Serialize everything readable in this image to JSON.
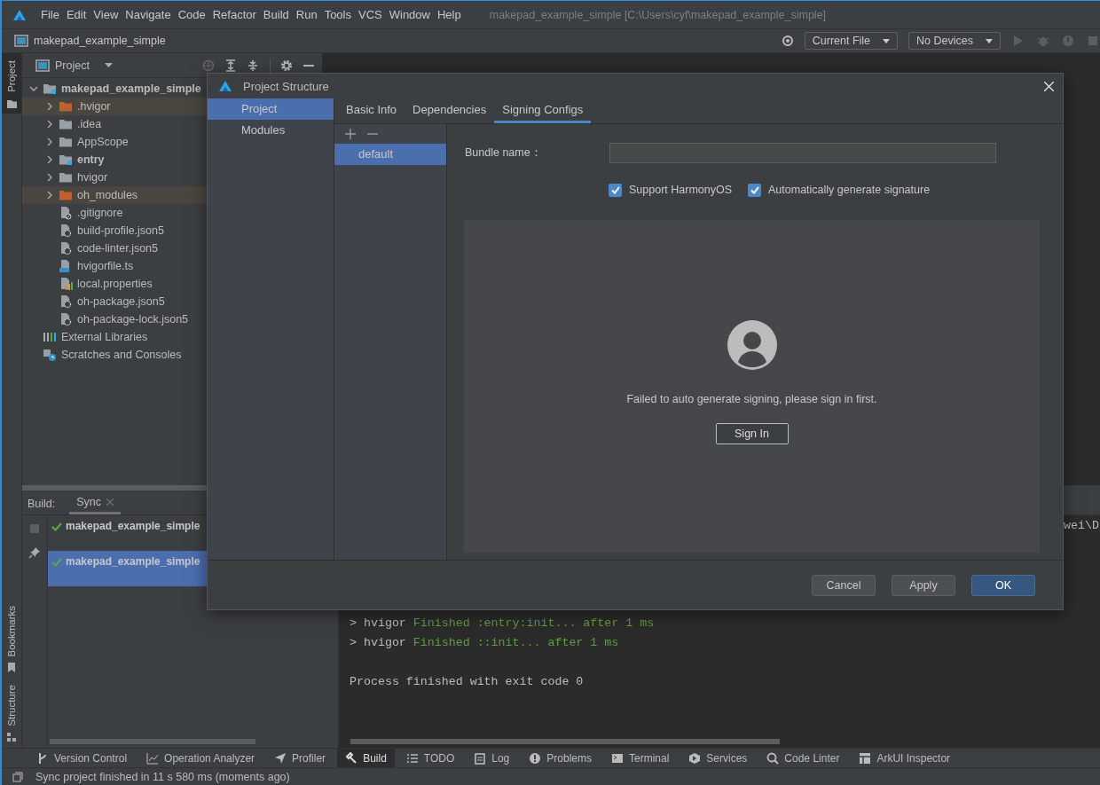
{
  "window": {
    "title": "makepad_example_simple [C:\\Users\\cyf\\makepad_example_simple]"
  },
  "menu": [
    {
      "label": "File"
    },
    {
      "label": "Edit"
    },
    {
      "label": "View"
    },
    {
      "label": "Navigate"
    },
    {
      "label": "Code"
    },
    {
      "label": "Refactor"
    },
    {
      "label": "Build"
    },
    {
      "label": "Run"
    },
    {
      "label": "Tools"
    },
    {
      "label": "VCS"
    },
    {
      "label": "Window"
    },
    {
      "label": "Help"
    }
  ],
  "navbar": {
    "project": "makepad_example_simple",
    "run_config": "Current File",
    "device": "No Devices"
  },
  "tool_strip": {
    "top": [
      {
        "label": "Project",
        "selected": true
      }
    ],
    "bottom": [
      {
        "label": "Bookmarks",
        "selected": false
      },
      {
        "label": "Structure",
        "selected": false
      }
    ]
  },
  "project_panel": {
    "title": "Project",
    "tree": [
      {
        "label": "makepad_example_simple",
        "kind": "module",
        "expanded": true,
        "children": [
          {
            "label": ".hvigor",
            "kind": "excluded-folder",
            "expanded": false
          },
          {
            "label": ".idea",
            "kind": "folder",
            "expanded": false
          },
          {
            "label": "AppScope",
            "kind": "folder",
            "expanded": false
          },
          {
            "label": "entry",
            "kind": "module",
            "expanded": false
          },
          {
            "label": "hvigor",
            "kind": "folder",
            "expanded": false
          },
          {
            "label": "oh_modules",
            "kind": "excluded-folder",
            "expanded": false
          },
          {
            "label": ".gitignore",
            "kind": "ignore-file"
          },
          {
            "label": "build-profile.json5",
            "kind": "json-file"
          },
          {
            "label": "code-linter.json5",
            "kind": "json-file"
          },
          {
            "label": "hvigorfile.ts",
            "kind": "ts-file"
          },
          {
            "label": "local.properties",
            "kind": "properties-file"
          },
          {
            "label": "oh-package.json5",
            "kind": "json-file"
          },
          {
            "label": "oh-package-lock.json5",
            "kind": "json-file"
          }
        ]
      },
      {
        "label": "External Libraries",
        "kind": "libraries"
      },
      {
        "label": "Scratches and Consoles",
        "kind": "scratches"
      }
    ]
  },
  "build": {
    "label": "Build:",
    "tabs": [
      {
        "label": "Sync",
        "selected": true
      }
    ],
    "tree": [
      {
        "label": "makepad_example_simple",
        "succeeded": true,
        "selected": false
      },
      {
        "label": "makepad_example_simple",
        "succeeded": true,
        "selected": true
      }
    ],
    "console": [
      {
        "segments": [
          {
            "text": "wei\\D",
            "kind": "plain"
          }
        ]
      },
      {
        "segments": [
          {
            "text": "> hvigor ",
            "kind": "plain"
          },
          {
            "text": "Finished :entry:init... after 1 ms",
            "kind": "success"
          }
        ]
      },
      {
        "segments": [
          {
            "text": "> hvigor ",
            "kind": "plain"
          },
          {
            "text": "Finished ::init... after 1 ms",
            "kind": "success"
          }
        ]
      },
      {
        "segments": [
          {
            "text": "Process finished with exit code 0",
            "kind": "plain"
          }
        ]
      }
    ]
  },
  "dialog": {
    "title": "Project Structure",
    "nav": [
      {
        "label": "Project",
        "selected": true
      },
      {
        "label": "Modules",
        "selected": false
      }
    ],
    "tabs": [
      {
        "label": "Basic Info",
        "selected": false
      },
      {
        "label": "Dependencies",
        "selected": false
      },
      {
        "label": "Signing Configs",
        "selected": true
      }
    ],
    "configs": [
      {
        "label": "default",
        "selected": true
      }
    ],
    "bundle_name": {
      "label": "Bundle name："
    },
    "checkboxes": [
      {
        "label": "Support HarmonyOS",
        "checked": true
      },
      {
        "label": "Automatically generate signature",
        "checked": true
      }
    ],
    "sign_in": {
      "message": "Failed to auto generate signing, please sign in first.",
      "button": "Sign In"
    },
    "buttons": [
      {
        "label": "Cancel",
        "kind": "secondary"
      },
      {
        "label": "Apply",
        "kind": "secondary"
      },
      {
        "label": "OK",
        "kind": "primary"
      }
    ]
  },
  "bottom_tabs": [
    {
      "label": "Version Control",
      "selected": false
    },
    {
      "label": "Operation Analyzer",
      "selected": false
    },
    {
      "label": "Profiler",
      "selected": false
    },
    {
      "label": "Build",
      "selected": true
    },
    {
      "label": "TODO",
      "selected": false
    },
    {
      "label": "Log",
      "selected": false
    },
    {
      "label": "Problems",
      "selected": false
    },
    {
      "label": "Terminal",
      "selected": false
    },
    {
      "label": "Services",
      "selected": false
    },
    {
      "label": "Code Linter",
      "selected": false
    },
    {
      "label": "ArkUI Inspector",
      "selected": false
    }
  ],
  "status_bar": {
    "message": "Sync project finished in 11 s 580 ms (moments ago)"
  }
}
